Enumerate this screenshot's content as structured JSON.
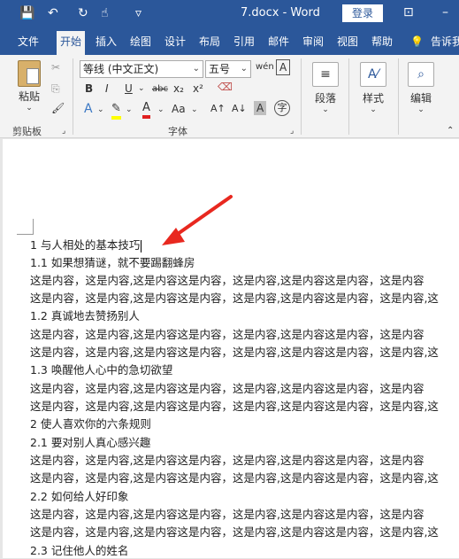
{
  "titlebar": {
    "doc_title": "7.docx  -  Word",
    "login": "登录",
    "save_icon": "💾",
    "undo_icon": "↶",
    "redo_icon": "↻",
    "touch_icon": "☝",
    "customize_icon": "▿"
  },
  "tabs": [
    "文件",
    "开始",
    "插入",
    "绘图",
    "设计",
    "布局",
    "引用",
    "邮件",
    "审阅",
    "视图",
    "帮助",
    "告诉我"
  ],
  "ribbon": {
    "paste_label": "粘贴",
    "clipboard_label": "剪贴板",
    "font_name": "等线 (中文正文)",
    "font_size": "五号",
    "font_group_label": "字体",
    "paragraph_label": "段落",
    "styles_label": "样式",
    "editing_label": "编辑",
    "bold": "B",
    "italic": "I",
    "underline": "U",
    "strike": "abc",
    "subscript": "x₂",
    "superscript": "x²",
    "font_color_a": "A",
    "char_shading": "A",
    "change_case": "Aa",
    "grow_a": "A",
    "wen": "wén",
    "char_border": "A",
    "circle_char": "字"
  },
  "document": {
    "lines": [
      "1 与人相处的基本技巧",
      "1.1 如果想猜谜，就不要踢翻蜂房",
      "这是内容，这是内容,这是内容这是内容，这是内容,这是内容这是内容，这是内容",
      "这是内容，这是内容,这是内容这是内容，这是内容,这是内容这是内容，这是内容,这",
      "1.2 真诚地去赞扬别人",
      "这是内容，这是内容,这是内容这是内容，这是内容,这是内容这是内容，这是内容",
      "这是内容，这是内容,这是内容这是内容，这是内容,这是内容这是内容，这是内容,这",
      "1.3 唤醒他人心中的急切欲望",
      "这是内容，这是内容,这是内容这是内容，这是内容,这是内容这是内容，这是内容",
      "这是内容，这是内容,这是内容这是内容，这是内容,这是内容这是内容，这是内容,这",
      "2 使人喜欢你的六条规则",
      "2.1 要对别人真心感兴趣",
      "这是内容，这是内容,这是内容这是内容，这是内容,这是内容这是内容，这是内容",
      "这是内容，这是内容,这是内容这是内容，这是内容,这是内容这是内容，这是内容,这",
      "2.2 如何给人好印象",
      "这是内容，这是内容,这是内容这是内容，这是内容,这是内容这是内容，这是内容",
      "这是内容，这是内容,这是内容这是内容，这是内容,这是内容这是内容，这是内容,这",
      "2.3 记住他人的姓名"
    ]
  }
}
